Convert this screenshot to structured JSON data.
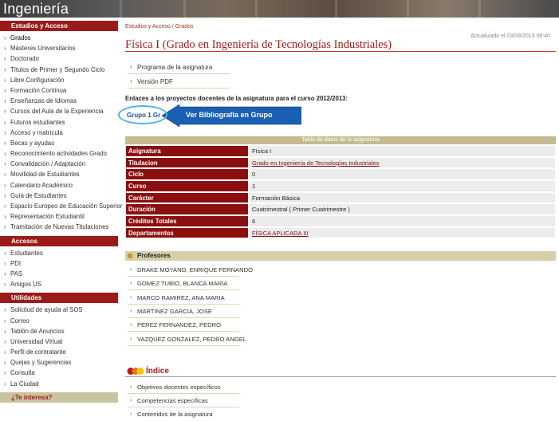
{
  "header": {
    "title": "Ingeniería"
  },
  "sidebar": {
    "sections": [
      {
        "title": "Estudios y Acceso",
        "items": [
          "Grados",
          "Másteres Universitarios",
          "Doctorado",
          "Títulos de Primer y Segundo Ciclo",
          "Libre Configuración",
          "Formación Continua",
          "Enseñanzas de Idiomas",
          "Cursos del Aula de la Experiencia",
          "Futuros estudiantes",
          "Acceso y matrícula",
          "Becas y ayudas",
          "Reconocimiento actividades Grado",
          "Convalidación / Adaptación",
          "Movilidad de Estudiantes",
          "Calendario Académico",
          "Guía de Estudiantes",
          "Espacio Europeo de Educación Superior",
          "Representación Estudiantil",
          "Tramitación de Nuevas Titulaciones"
        ]
      },
      {
        "title": "Accesos",
        "items": [
          "Estudiantes",
          "PDI",
          "PAS",
          "Amigos US"
        ]
      },
      {
        "title": "Utilidades",
        "items": [
          "Solicitud de ayuda al SOS",
          "Correo",
          "Tablón de Anuncios",
          "Universidad Virtual",
          "Perfil de contratante",
          "Quejas y Sugerencias",
          "Consulta",
          "La Ciudad"
        ]
      }
    ],
    "footer_section": "¿Te interesa?"
  },
  "breadcrumb": "Estudios y Acceso / Grados",
  "updated": "Actualizado el 03/09/2013 09:40",
  "page_title": "Física I (Grado en Ingeniería de Tecnologías Industriales)",
  "links": {
    "programa": "Programa de la asignatura",
    "version_pdf": "Versión PDF"
  },
  "enlaces_text": "Enlaces a los proyectos docentes de la asignatura para el curso 2012/2013:",
  "grupo_link": "Grupo 1 Gr",
  "callout": "Ver Bibliografía en Grupo",
  "table": {
    "caption": "Tabla de datos de la asignatura",
    "rows": [
      {
        "label": "Asignatura",
        "value": "Física I"
      },
      {
        "label": "Titulacion",
        "value": "Grado en Ingeniería de Tecnologías Industriales"
      },
      {
        "label": "Ciclo",
        "value": "0"
      },
      {
        "label": "Curso",
        "value": "1"
      },
      {
        "label": "Carácter",
        "value": "Formación Básica"
      },
      {
        "label": "Duración",
        "value": "Cuatrimestral ( Primer Cuatrimestre )"
      },
      {
        "label": "Créditos Totales",
        "value": "6"
      },
      {
        "label": "Departamentos",
        "value": "FÍSICA APLICADA III"
      }
    ]
  },
  "profesores": {
    "title": "Profesores",
    "items": [
      "DRAKE MOYANO, ENRIQUE FERNANDO",
      "GOMEZ TUBIO, BLANCA MARIA",
      "MARCO RAMIREZ, ANA MARIA",
      "MARTINEZ GARCIA, JOSE",
      "PEREZ FERNANDEZ, PEDRO",
      "VAZQUEZ GONZALEZ, PEDRO ANGEL"
    ]
  },
  "indice": {
    "title": "Índice",
    "items": [
      "Objetivos docentes específicos",
      "Competencias específicas",
      "Contenidos de la asignatura"
    ]
  },
  "colors": {
    "brand": "#9b1b1b",
    "accent_blue": "#1a5fb4",
    "highlight_circle": "#4fb3e8",
    "table_label": "#8b0f0f"
  }
}
